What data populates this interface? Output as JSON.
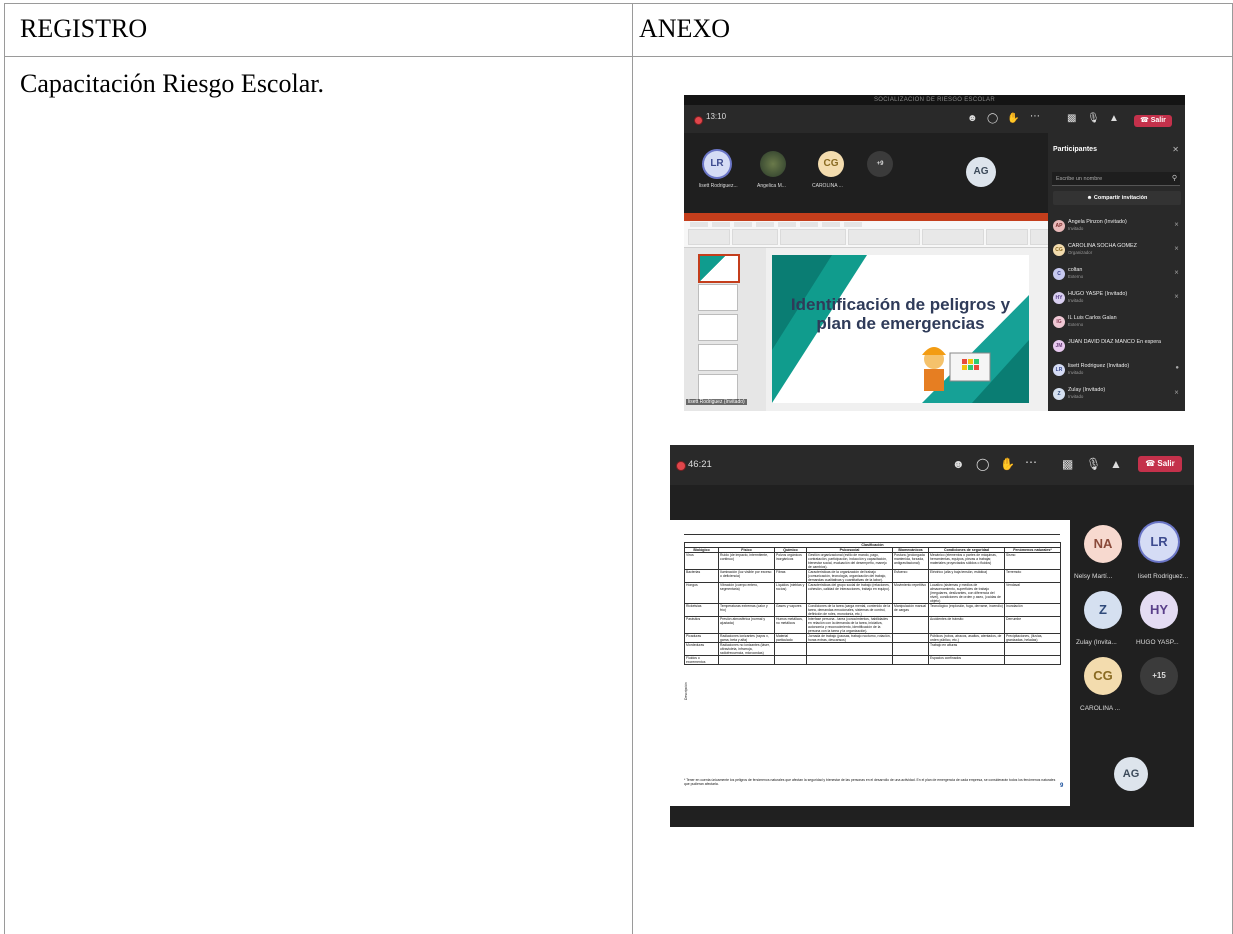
{
  "table": {
    "header": {
      "col1": "REGISTRO",
      "col2": "ANEXO"
    },
    "row1": {
      "registro": "Capacitación Riesgo Escolar."
    }
  },
  "screenshot1": {
    "window_title": "SOCIALIZACION DE RIESGO ESCOLAR",
    "time": "13:10",
    "leave_label": "Salir",
    "tiles": [
      {
        "initials": "LR",
        "name": "lisett Rodriguez..."
      },
      {
        "initials": "",
        "name": "Angelica M..."
      },
      {
        "initials": "CG",
        "name": "CAROLINA ..."
      },
      {
        "initials": "+9",
        "name": ""
      },
      {
        "initials": "AG",
        "name": ""
      }
    ],
    "slide_title": "Identificación de peligros y plan de emergencias",
    "presenter": "lisett Rodriguez (Invitado)",
    "panel": {
      "title": "Participantes",
      "search_placeholder": "Escribe un nombre",
      "invite_label": "Compartir invitación",
      "participants": [
        {
          "initials": "AP",
          "name": "Angela Pinzon (Invitado)",
          "role": "Invitado"
        },
        {
          "initials": "CG",
          "name": "CAROLINA SOCHA GOMEZ",
          "role": "Organizador"
        },
        {
          "initials": "C",
          "name": "coltan",
          "role": "Externo"
        },
        {
          "initials": "HY",
          "name": "HUGO YASPE (Invitado)",
          "role": "Invitado"
        },
        {
          "initials": "IG",
          "name": "IL Luis Carlos Galan",
          "role": "Externo"
        },
        {
          "initials": "JM",
          "name": "JUAN DAVID DIAZ MANCO En espera",
          "role": ""
        },
        {
          "initials": "LR",
          "name": "lisett Rodriguez (Invitado)",
          "role": "Invitado"
        },
        {
          "initials": "Z",
          "name": "Zulay (Invitado)",
          "role": "Invitado"
        }
      ]
    }
  },
  "screenshot2": {
    "time": "46:21",
    "leave_label": "Salir",
    "tiles": [
      {
        "initials": "NA",
        "name": "Nelsy Martí..."
      },
      {
        "initials": "LR",
        "name": "lisett Rodriguez..."
      },
      {
        "initials": "Z",
        "name": "Zulay (Invita..."
      },
      {
        "initials": "HY",
        "name": "HUGO YASP..."
      },
      {
        "initials": "CG",
        "name": "CAROLINA ..."
      },
      {
        "initials": "+15",
        "name": ""
      },
      {
        "initials": "AG",
        "name": ""
      }
    ],
    "doc": {
      "clasificacion": "Clasificación",
      "side_label": "Descripción",
      "columns": [
        "Biológico",
        "Físico",
        "Químico",
        "Psicosocial",
        "Biomecánicos",
        "Condiciones de seguridad",
        "Fenómenos naturales*"
      ],
      "rows": [
        [
          "Virus",
          "Ruido (de impacto, intermitente, continuo)",
          "Polvos orgánicos inorgánicos",
          "Gestión organizacional (estilo de mando, pago, contratación, participación, inducción y capacitación, bienestar social, evaluación del desempeño, manejo de cambios).",
          "Postura (prolongada mantenida, forzada, antigravitacional)",
          "Mecánico (elementos o partes de máquinas, herramientas, equipos, piezas a trabajar, materiales proyectados sólidos o fluidos)",
          "Sismo"
        ],
        [
          "Bacterias",
          "Iluminación (luz visible por exceso o deficiencia)",
          "Fibras",
          "Características de la organización del trabajo (comunicación, tecnología, organización del trabajo, demandas cualitativas y cuantitativas de la labor).",
          "Esfuerzo",
          "Eléctrico (alta y baja tensión, estática)",
          "Terremoto"
        ],
        [
          "Hongos",
          "Vibración (cuerpo entero, segmentaria)",
          "Líquidos (nieblas y rocíos)",
          "Características del grupo social de trabajo (relaciones, cohesión, calidad de interacciones, trabajo en equipo).",
          "Movimiento repetitivo",
          "Locativo (sistemas y medios de almacenamiento, superficies de trabajo (irregulares, deslizantes, con diferencia del nivel), condiciones de orden y aseo, (caídas de objeto)",
          "Vendaval"
        ],
        [
          "Ricketsias",
          "Temperaturas extremas (calor y frío)",
          "Gases y vapores",
          "Condiciones de la tarea (carga mental, contenido de la tarea, demandas emocionales, sistemas de control, definición de roles, monotonía, etc.)",
          "Manipulación manual de cargas",
          "Tecnológico (explosión, fuga, derrame, incendio)",
          "Inundación"
        ],
        [
          "Parásitos",
          "Presión atmosférica (normal y ajustada)",
          "Humos metálicos, no metálicos",
          "Interfase persona - tarea (conocimientos, habilidades en relación con la demanda de la tarea, iniciativa, autonomía y reconocimiento, identificación de la persona con la tarea y la organización).",
          "",
          "Accidentes de tránsito",
          "Derrumbe"
        ],
        [
          "Picaduras",
          "Radiaciones ionizantes (rayos x, gama, beta y alfa)",
          "Material particulado",
          "Jornada de trabajo (pausas, trabajo nocturno, rotación, horas extras, descansos)",
          "",
          "Públicos (robos, atracos, asaltos, atentados, de orden público, etc.)",
          "Precipitaciones, (lluvias, granizadas, heladas)"
        ],
        [
          "Mordeduras",
          "Radiaciones no ionizantes (láser, ultravioleta, infrarroja, radiofrecuencia, microondas)",
          "",
          "",
          "",
          "Trabajo en alturas",
          ""
        ],
        [
          "Fluidos o excrementos",
          "",
          "",
          "",
          "",
          "Espacios confinados",
          ""
        ]
      ],
      "note": "* Tener en cuenta únicamente los peligros de fenómenos naturales que afectan la seguridad y bienestar de las personas en el desarrollo de una actividad. En el plan de emergencia de cada empresa, se considerarán todos los fenómenos naturales que pudieran afectarla.",
      "page_number": "9"
    }
  }
}
